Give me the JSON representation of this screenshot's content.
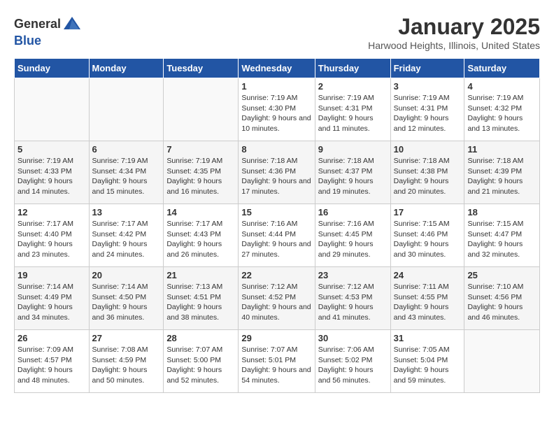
{
  "logo": {
    "general": "General",
    "blue": "Blue"
  },
  "title": "January 2025",
  "location": "Harwood Heights, Illinois, United States",
  "days_of_week": [
    "Sunday",
    "Monday",
    "Tuesday",
    "Wednesday",
    "Thursday",
    "Friday",
    "Saturday"
  ],
  "weeks": [
    [
      {
        "day": "",
        "sunrise": "",
        "sunset": "",
        "daylight": ""
      },
      {
        "day": "",
        "sunrise": "",
        "sunset": "",
        "daylight": ""
      },
      {
        "day": "",
        "sunrise": "",
        "sunset": "",
        "daylight": ""
      },
      {
        "day": "1",
        "sunrise": "Sunrise: 7:19 AM",
        "sunset": "Sunset: 4:30 PM",
        "daylight": "Daylight: 9 hours and 10 minutes."
      },
      {
        "day": "2",
        "sunrise": "Sunrise: 7:19 AM",
        "sunset": "Sunset: 4:31 PM",
        "daylight": "Daylight: 9 hours and 11 minutes."
      },
      {
        "day": "3",
        "sunrise": "Sunrise: 7:19 AM",
        "sunset": "Sunset: 4:31 PM",
        "daylight": "Daylight: 9 hours and 12 minutes."
      },
      {
        "day": "4",
        "sunrise": "Sunrise: 7:19 AM",
        "sunset": "Sunset: 4:32 PM",
        "daylight": "Daylight: 9 hours and 13 minutes."
      }
    ],
    [
      {
        "day": "5",
        "sunrise": "Sunrise: 7:19 AM",
        "sunset": "Sunset: 4:33 PM",
        "daylight": "Daylight: 9 hours and 14 minutes."
      },
      {
        "day": "6",
        "sunrise": "Sunrise: 7:19 AM",
        "sunset": "Sunset: 4:34 PM",
        "daylight": "Daylight: 9 hours and 15 minutes."
      },
      {
        "day": "7",
        "sunrise": "Sunrise: 7:19 AM",
        "sunset": "Sunset: 4:35 PM",
        "daylight": "Daylight: 9 hours and 16 minutes."
      },
      {
        "day": "8",
        "sunrise": "Sunrise: 7:18 AM",
        "sunset": "Sunset: 4:36 PM",
        "daylight": "Daylight: 9 hours and 17 minutes."
      },
      {
        "day": "9",
        "sunrise": "Sunrise: 7:18 AM",
        "sunset": "Sunset: 4:37 PM",
        "daylight": "Daylight: 9 hours and 19 minutes."
      },
      {
        "day": "10",
        "sunrise": "Sunrise: 7:18 AM",
        "sunset": "Sunset: 4:38 PM",
        "daylight": "Daylight: 9 hours and 20 minutes."
      },
      {
        "day": "11",
        "sunrise": "Sunrise: 7:18 AM",
        "sunset": "Sunset: 4:39 PM",
        "daylight": "Daylight: 9 hours and 21 minutes."
      }
    ],
    [
      {
        "day": "12",
        "sunrise": "Sunrise: 7:17 AM",
        "sunset": "Sunset: 4:40 PM",
        "daylight": "Daylight: 9 hours and 23 minutes."
      },
      {
        "day": "13",
        "sunrise": "Sunrise: 7:17 AM",
        "sunset": "Sunset: 4:42 PM",
        "daylight": "Daylight: 9 hours and 24 minutes."
      },
      {
        "day": "14",
        "sunrise": "Sunrise: 7:17 AM",
        "sunset": "Sunset: 4:43 PM",
        "daylight": "Daylight: 9 hours and 26 minutes."
      },
      {
        "day": "15",
        "sunrise": "Sunrise: 7:16 AM",
        "sunset": "Sunset: 4:44 PM",
        "daylight": "Daylight: 9 hours and 27 minutes."
      },
      {
        "day": "16",
        "sunrise": "Sunrise: 7:16 AM",
        "sunset": "Sunset: 4:45 PM",
        "daylight": "Daylight: 9 hours and 29 minutes."
      },
      {
        "day": "17",
        "sunrise": "Sunrise: 7:15 AM",
        "sunset": "Sunset: 4:46 PM",
        "daylight": "Daylight: 9 hours and 30 minutes."
      },
      {
        "day": "18",
        "sunrise": "Sunrise: 7:15 AM",
        "sunset": "Sunset: 4:47 PM",
        "daylight": "Daylight: 9 hours and 32 minutes."
      }
    ],
    [
      {
        "day": "19",
        "sunrise": "Sunrise: 7:14 AM",
        "sunset": "Sunset: 4:49 PM",
        "daylight": "Daylight: 9 hours and 34 minutes."
      },
      {
        "day": "20",
        "sunrise": "Sunrise: 7:14 AM",
        "sunset": "Sunset: 4:50 PM",
        "daylight": "Daylight: 9 hours and 36 minutes."
      },
      {
        "day": "21",
        "sunrise": "Sunrise: 7:13 AM",
        "sunset": "Sunset: 4:51 PM",
        "daylight": "Daylight: 9 hours and 38 minutes."
      },
      {
        "day": "22",
        "sunrise": "Sunrise: 7:12 AM",
        "sunset": "Sunset: 4:52 PM",
        "daylight": "Daylight: 9 hours and 40 minutes."
      },
      {
        "day": "23",
        "sunrise": "Sunrise: 7:12 AM",
        "sunset": "Sunset: 4:53 PM",
        "daylight": "Daylight: 9 hours and 41 minutes."
      },
      {
        "day": "24",
        "sunrise": "Sunrise: 7:11 AM",
        "sunset": "Sunset: 4:55 PM",
        "daylight": "Daylight: 9 hours and 43 minutes."
      },
      {
        "day": "25",
        "sunrise": "Sunrise: 7:10 AM",
        "sunset": "Sunset: 4:56 PM",
        "daylight": "Daylight: 9 hours and 46 minutes."
      }
    ],
    [
      {
        "day": "26",
        "sunrise": "Sunrise: 7:09 AM",
        "sunset": "Sunset: 4:57 PM",
        "daylight": "Daylight: 9 hours and 48 minutes."
      },
      {
        "day": "27",
        "sunrise": "Sunrise: 7:08 AM",
        "sunset": "Sunset: 4:59 PM",
        "daylight": "Daylight: 9 hours and 50 minutes."
      },
      {
        "day": "28",
        "sunrise": "Sunrise: 7:07 AM",
        "sunset": "Sunset: 5:00 PM",
        "daylight": "Daylight: 9 hours and 52 minutes."
      },
      {
        "day": "29",
        "sunrise": "Sunrise: 7:07 AM",
        "sunset": "Sunset: 5:01 PM",
        "daylight": "Daylight: 9 hours and 54 minutes."
      },
      {
        "day": "30",
        "sunrise": "Sunrise: 7:06 AM",
        "sunset": "Sunset: 5:02 PM",
        "daylight": "Daylight: 9 hours and 56 minutes."
      },
      {
        "day": "31",
        "sunrise": "Sunrise: 7:05 AM",
        "sunset": "Sunset: 5:04 PM",
        "daylight": "Daylight: 9 hours and 59 minutes."
      },
      {
        "day": "",
        "sunrise": "",
        "sunset": "",
        "daylight": ""
      }
    ]
  ]
}
